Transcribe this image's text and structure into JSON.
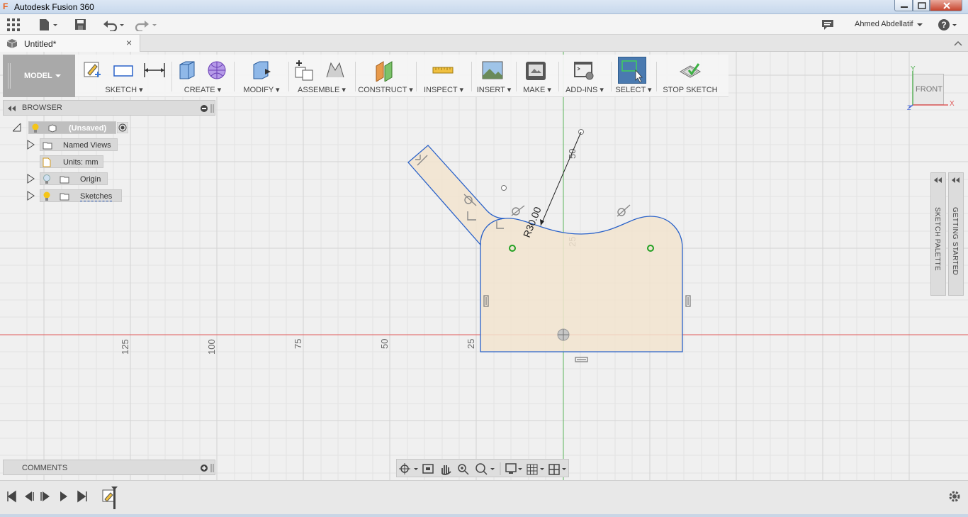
{
  "window": {
    "title": "Autodesk Fusion 360"
  },
  "appbar": {
    "user": "Ahmed Abdellatif",
    "help": "?"
  },
  "tabs": [
    {
      "label": "Untitled*",
      "close": "×"
    }
  ],
  "toolbar": {
    "workspace": "MODEL",
    "groups": [
      {
        "label": "SKETCH ▾"
      },
      {
        "label": "CREATE ▾"
      },
      {
        "label": "MODIFY ▾"
      },
      {
        "label": "ASSEMBLE ▾"
      },
      {
        "label": "CONSTRUCT ▾"
      },
      {
        "label": "INSPECT ▾"
      },
      {
        "label": "INSERT ▾"
      },
      {
        "label": "MAKE ▾"
      },
      {
        "label": "ADD-INS ▾"
      },
      {
        "label": "SELECT ▾"
      },
      {
        "label": "STOP SKETCH"
      }
    ]
  },
  "browser": {
    "title": "BROWSER",
    "items": [
      {
        "label": "(Unsaved)"
      },
      {
        "label": "Named Views"
      },
      {
        "label": "Units: mm"
      },
      {
        "label": "Origin"
      },
      {
        "label": "Sketches"
      }
    ]
  },
  "comments": {
    "title": "COMMENTS"
  },
  "canvas": {
    "axis_ticks": [
      "125",
      "100",
      "75",
      "50",
      "25"
    ],
    "vertical_ticks": [
      "50",
      "25"
    ],
    "dimension": "R30.00"
  },
  "palettes": {
    "sketch": "SKETCH PALETTE",
    "getting_started": "GETTING STARTED"
  },
  "viewcube": {
    "face": "FRONT",
    "axis_x": "X",
    "axis_y": "Y",
    "axis_z": "Z"
  },
  "colors": {
    "sketch_fill": "#f2e4cf",
    "sketch_line": "#2a62c9",
    "x_axis": "#e05a5a",
    "y_axis": "#5ab35a",
    "select_active": "#4a7ab0"
  }
}
